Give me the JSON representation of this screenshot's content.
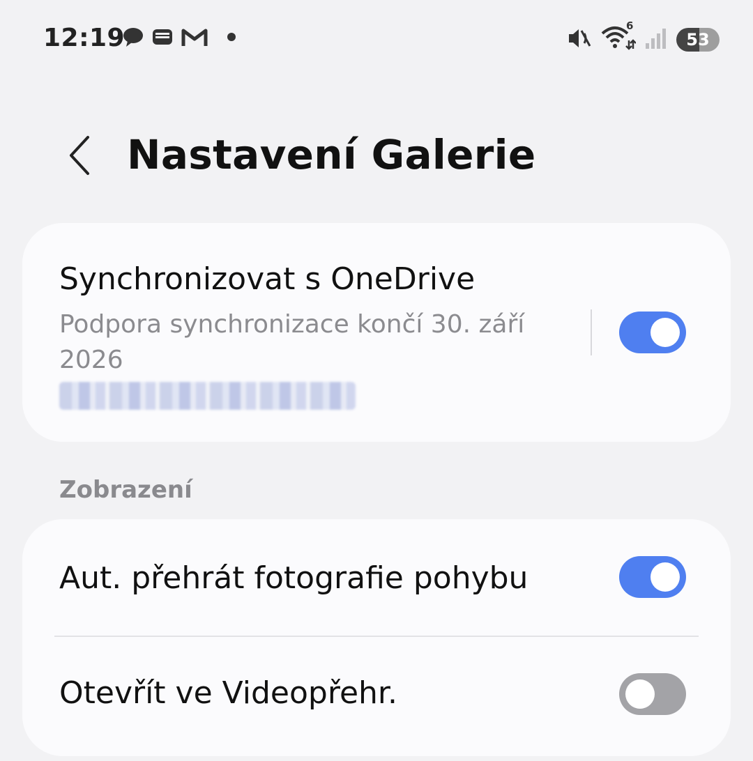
{
  "status_bar": {
    "time": "12:19",
    "notification_icons": [
      "chat-bubble-icon",
      "wallet-icon",
      "gmail-icon",
      "more-dot-icon"
    ],
    "system_icons": [
      "mute-vibrate-icon",
      "wifi-icon",
      "signal-icon"
    ],
    "wifi_badge": "6",
    "battery_level": "53"
  },
  "header": {
    "title": "Nastavení Galerie"
  },
  "sync_card": {
    "title": "Synchronizovat s OneDrive",
    "subtitle": "Podpora synchronizace končí 30. září 2026",
    "toggle_on": true
  },
  "display_section": {
    "header": "Zobrazení",
    "items": [
      {
        "label": "Aut. přehrát fotografie pohybu",
        "toggle_on": true
      },
      {
        "label": "Otevřít ve Videopřehr.",
        "toggle_on": false
      }
    ]
  },
  "colors": {
    "toggle_on": "#4f7ff0",
    "toggle_off": "#a3a3a7",
    "background": "#f2f2f4",
    "card": "#fbfbfd"
  }
}
